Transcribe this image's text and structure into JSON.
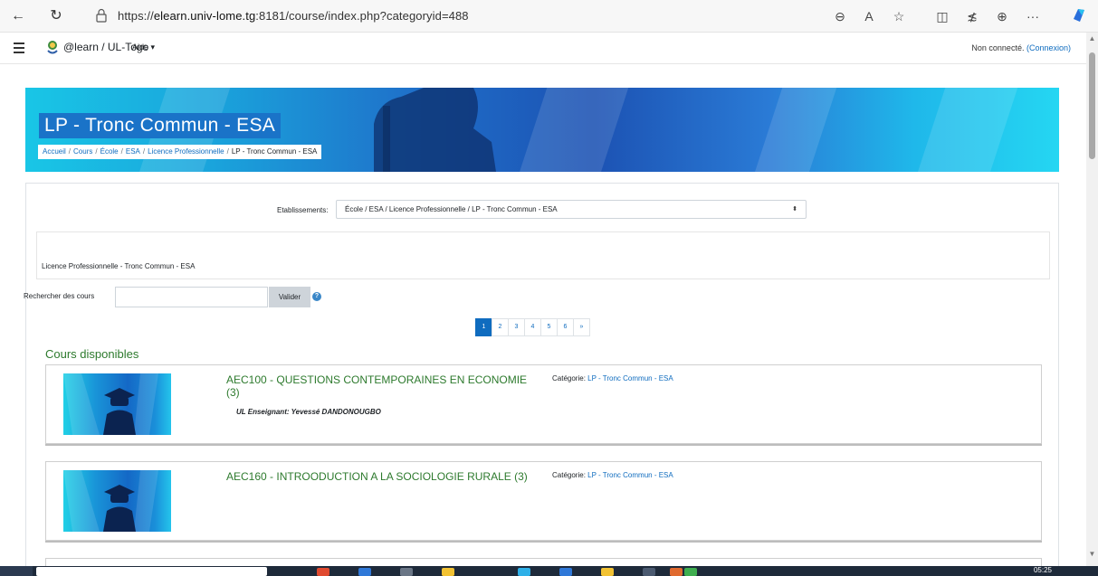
{
  "browser": {
    "url_prefix": "https://",
    "url_host": "elearn.univ-lome.tg",
    "url_rest": ":8181/course/index.php?categoryid=488"
  },
  "navbar": {
    "site_name": "@learn / UL-Togo",
    "help_menu": "Aide ▾",
    "login_status": "Non connecté.",
    "login_link": "(Connexion)"
  },
  "header": {
    "title": "LP - Tronc Commun - ESA",
    "breadcrumb": [
      "Accueil",
      "Cours",
      "École",
      "ESA",
      "Licence Professionnelle",
      "LP - Tronc Commun - ESA"
    ]
  },
  "category_select": {
    "label": "Etablissements:",
    "selected": "École / ESA / Licence Professionnelle / LP - Tronc Commun - ESA"
  },
  "description": "Licence Professionnelle - Tronc Commun - ESA",
  "search": {
    "label": "Rechercher des cours",
    "value": "",
    "button": "Valider",
    "help": "?"
  },
  "pagination": {
    "pages": [
      "1",
      "2",
      "3",
      "4",
      "5",
      "6",
      "»"
    ],
    "active": "1"
  },
  "courses_heading": "Cours disponibles",
  "courses": [
    {
      "name": "AEC100 - QUESTIONS CONTEMPORAINES EN ECONOMIE (3)",
      "category_label": "Catégorie:",
      "category": "LP - Tronc Commun - ESA",
      "teacher": "UL Enseignant: Yevessé DANDONOUGBO"
    },
    {
      "name": "AEC160 - INTROODUCTION A LA SOCIOLOGIE RURALE (3)",
      "category_label": "Catégorie:",
      "category": "LP - Tronc Commun - ESA",
      "teacher": ""
    }
  ],
  "taskbar": {
    "time": "05:25"
  },
  "colors": {
    "accent": "#0f6cbf",
    "course_title": "#2d7a2d",
    "banner": "#1c52b3"
  }
}
